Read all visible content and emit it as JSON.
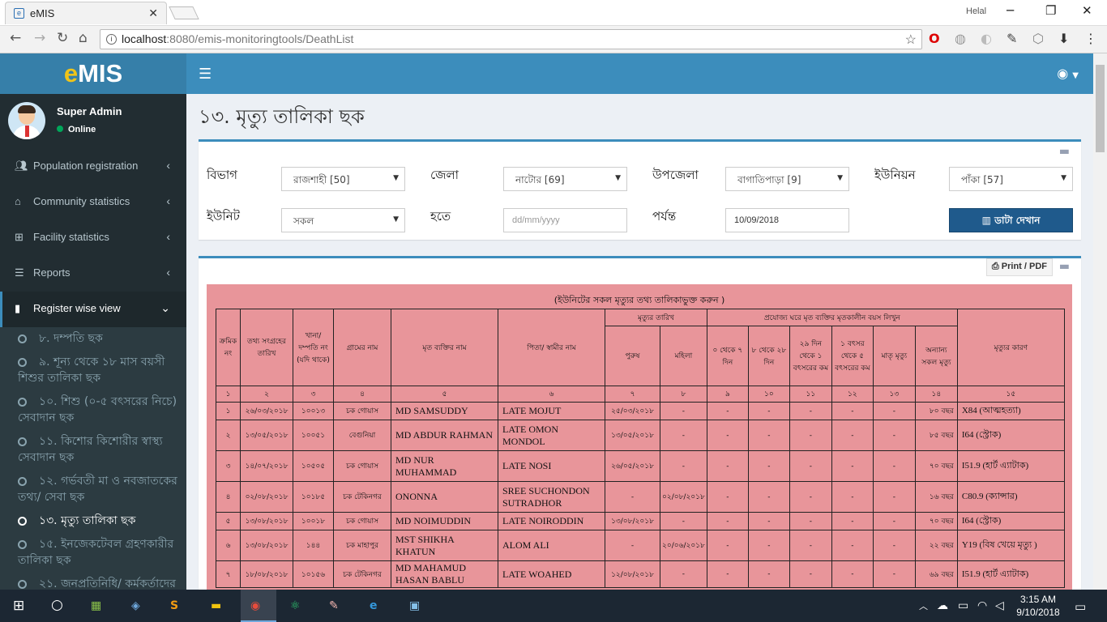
{
  "browser": {
    "tab_title": "eMIS",
    "user_label": "Helal",
    "url_host": "localhost",
    "url_path": ":8080/emis-monitoringtools/DeathList"
  },
  "app": {
    "logo_e": "e",
    "logo_rest": "MIS",
    "user_name": "Super Admin",
    "user_status": "Online"
  },
  "sidebar": {
    "items": [
      {
        "label": "Population registration",
        "icon": "users-icon"
      },
      {
        "label": "Community statistics",
        "icon": "home-icon"
      },
      {
        "label": "Facility statistics",
        "icon": "medkit-icon"
      },
      {
        "label": "Reports",
        "icon": "list-icon"
      },
      {
        "label": "Register wise view",
        "icon": "book-icon"
      }
    ],
    "sub_items": [
      "৮. দম্পতি ছক",
      "৯. শূন্য থেকে ১৮ মাস বয়সী শিশুর তালিকা ছক",
      "১০. শিশু (০-৫ বৎসরের নিচে) সেবাদান ছক",
      "১১. কিশোর কিশোরীর স্বাস্থ্য সেবাদান ছক",
      "১২. গর্ভবতী মা ও নবজাতকের তথ্য/ সেবা ছক",
      "১৩. মৃত্যু তালিকা ছক",
      "১৫. ইনজেকটেবল গ্রহণকারীর তালিকা ছক",
      "২১. জনপ্রতিনিধি/ কর্মকর্তাদের"
    ]
  },
  "page": {
    "title": "১৩. মৃত্যু তালিকা ছক"
  },
  "filters": {
    "division_label": "বিভাগ",
    "division_value": "রাজশাহী [50]",
    "district_label": "জেলা",
    "district_value": "নাটোর [69]",
    "upazila_label": "উপজেলা",
    "upazila_value": "বাগাতিপাড়া [9]",
    "union_label": "ইউনিয়ন",
    "union_value": "পাঁকা [57]",
    "unit_label": "ইউনিট",
    "unit_value": "সকল",
    "from_label": "হতে",
    "from_placeholder": "dd/mm/yyyy",
    "to_label": "পর্যন্ত",
    "to_value": "10/09/2018",
    "show_button": "ডাটা দেখান"
  },
  "report": {
    "print_label": "Print / PDF",
    "title": "(ইউনিটের সকল মৃত্যুর তথ্য তালিকাভুক্ত করুন )",
    "headers": {
      "serial": "ক্রমিক নং",
      "collect_date": "তথ্য সংগ্রহের তারিখ",
      "hh_no": "খানা/ দম্পতি নং (যদি থাকে)",
      "village": "গ্রামের নাম",
      "name": "মৃত ব্যক্তির নাম",
      "father": "পিতা/ স্বামীর নাম",
      "death_date_group": "মৃত্যুর তারিখ",
      "male": "পুরুষ",
      "female": "মহিলা",
      "age_group": "প্রযোজ্য ঘরে মৃত ব্যক্তির মৃতকালীন বয়স লিখুন",
      "age_0_7": "০ থেকে ৭ দিন",
      "age_8_28": "৮ থেকে ২৮ দিন",
      "age_29_1y": "২৯ দিন থেকে ১ বৎসরের কম",
      "age_1_5y": "১ বৎসর থেকে ৫ বৎসরের কম",
      "maternal": "মাতৃ মৃত্যু",
      "other": "অন্যান্য সকল মৃত্যু",
      "cause": "মৃত্যুর কারণ"
    },
    "col_numbers": [
      "১",
      "২",
      "৩",
      "৪",
      "৫",
      "৬",
      "৭",
      "৮",
      "৯",
      "১০",
      "১১",
      "১২",
      "১৩",
      "১৪",
      "১৫"
    ],
    "rows": [
      {
        "sl": "১",
        "date": "২৬/০৩/২০১৮",
        "hh": "১০০১৩",
        "village": "চক গোয়াস",
        "name": "MD SAMSUDDY",
        "father": "LATE MOJUT",
        "male": "২৫/০৩/২০১৮",
        "female": "-",
        "a1": "-",
        "a2": "-",
        "a3": "-",
        "a4": "-",
        "mat": "-",
        "age": "৮০ বছর",
        "cause": "X84 (আত্মহত্যা)"
      },
      {
        "sl": "২",
        "date": "১৩/০৫/২০১৮",
        "hh": "১০০৫১",
        "village": "বেগুনিয়া",
        "name": "MD ABDUR RAHMAN",
        "father": "LATE OMON MONDOL",
        "male": "১৩/০৫/২০১৮",
        "female": "-",
        "a1": "-",
        "a2": "-",
        "a3": "-",
        "a4": "-",
        "mat": "-",
        "age": "৮৫ বছর",
        "cause": "I64 (স্ট্রোক)"
      },
      {
        "sl": "৩",
        "date": "১৪/০৭/২০১৮",
        "hh": "১০৫০৫",
        "village": "চক গোয়াস",
        "name": "MD NUR MUHAMMAD",
        "father": "LATE NOSI",
        "male": "২৬/০৫/২০১৮",
        "female": "-",
        "a1": "-",
        "a2": "-",
        "a3": "-",
        "a4": "-",
        "mat": "-",
        "age": "৭০ বছর",
        "cause": "I51.9 (হার্ট এ্যাটাক)"
      },
      {
        "sl": "৪",
        "date": "০২/০৮/২০১৮",
        "hh": "১০১৮৫",
        "village": "চক টেকিনগর",
        "name": "ONONNA",
        "father": "SREE SUCHONDON SUTRADHOR",
        "male": "-",
        "female": "০২/০৮/২০১৮",
        "a1": "-",
        "a2": "-",
        "a3": "-",
        "a4": "-",
        "mat": "-",
        "age": "১৬ বছর",
        "cause": "C80.9 (ক্যান্সার)"
      },
      {
        "sl": "৫",
        "date": "১৩/০৮/২০১৮",
        "hh": "১০০১৮",
        "village": "চক গোয়াস",
        "name": "MD NOIMUDDIN",
        "father": "LATE NOIRODDIN",
        "male": "১৩/০৮/২০১৮",
        "female": "-",
        "a1": "-",
        "a2": "-",
        "a3": "-",
        "a4": "-",
        "mat": "-",
        "age": "৭০ বছর",
        "cause": "I64 (স্ট্রোক)"
      },
      {
        "sl": "৬",
        "date": "১৩/০৮/২০১৮",
        "hh": "১৪৪",
        "village": "চক মাহাপুর",
        "name": "MST SHIKHA KHATUN",
        "father": "ALOM ALI",
        "male": "-",
        "female": "২০/০৬/২০১৮",
        "a1": "-",
        "a2": "-",
        "a3": "-",
        "a4": "-",
        "mat": "-",
        "age": "২২ বছর",
        "cause": "Y19 (বিষ খেয়ে মৃত্যু )"
      },
      {
        "sl": "৭",
        "date": "১৮/০৮/২০১৮",
        "hh": "১০১৫৬",
        "village": "চক টেকিনগর",
        "name": "MD MAHAMUD HASAN BABLU",
        "father": "LATE WOAHED",
        "male": "১২/০৮/২০১৮",
        "female": "-",
        "a1": "-",
        "a2": "-",
        "a3": "-",
        "a4": "-",
        "mat": "-",
        "age": "৬৯ বছর",
        "cause": "I51.9 (হার্ট এ্যাটাক)"
      }
    ]
  },
  "taskbar": {
    "time": "3:15 AM",
    "date": "9/10/2018"
  }
}
